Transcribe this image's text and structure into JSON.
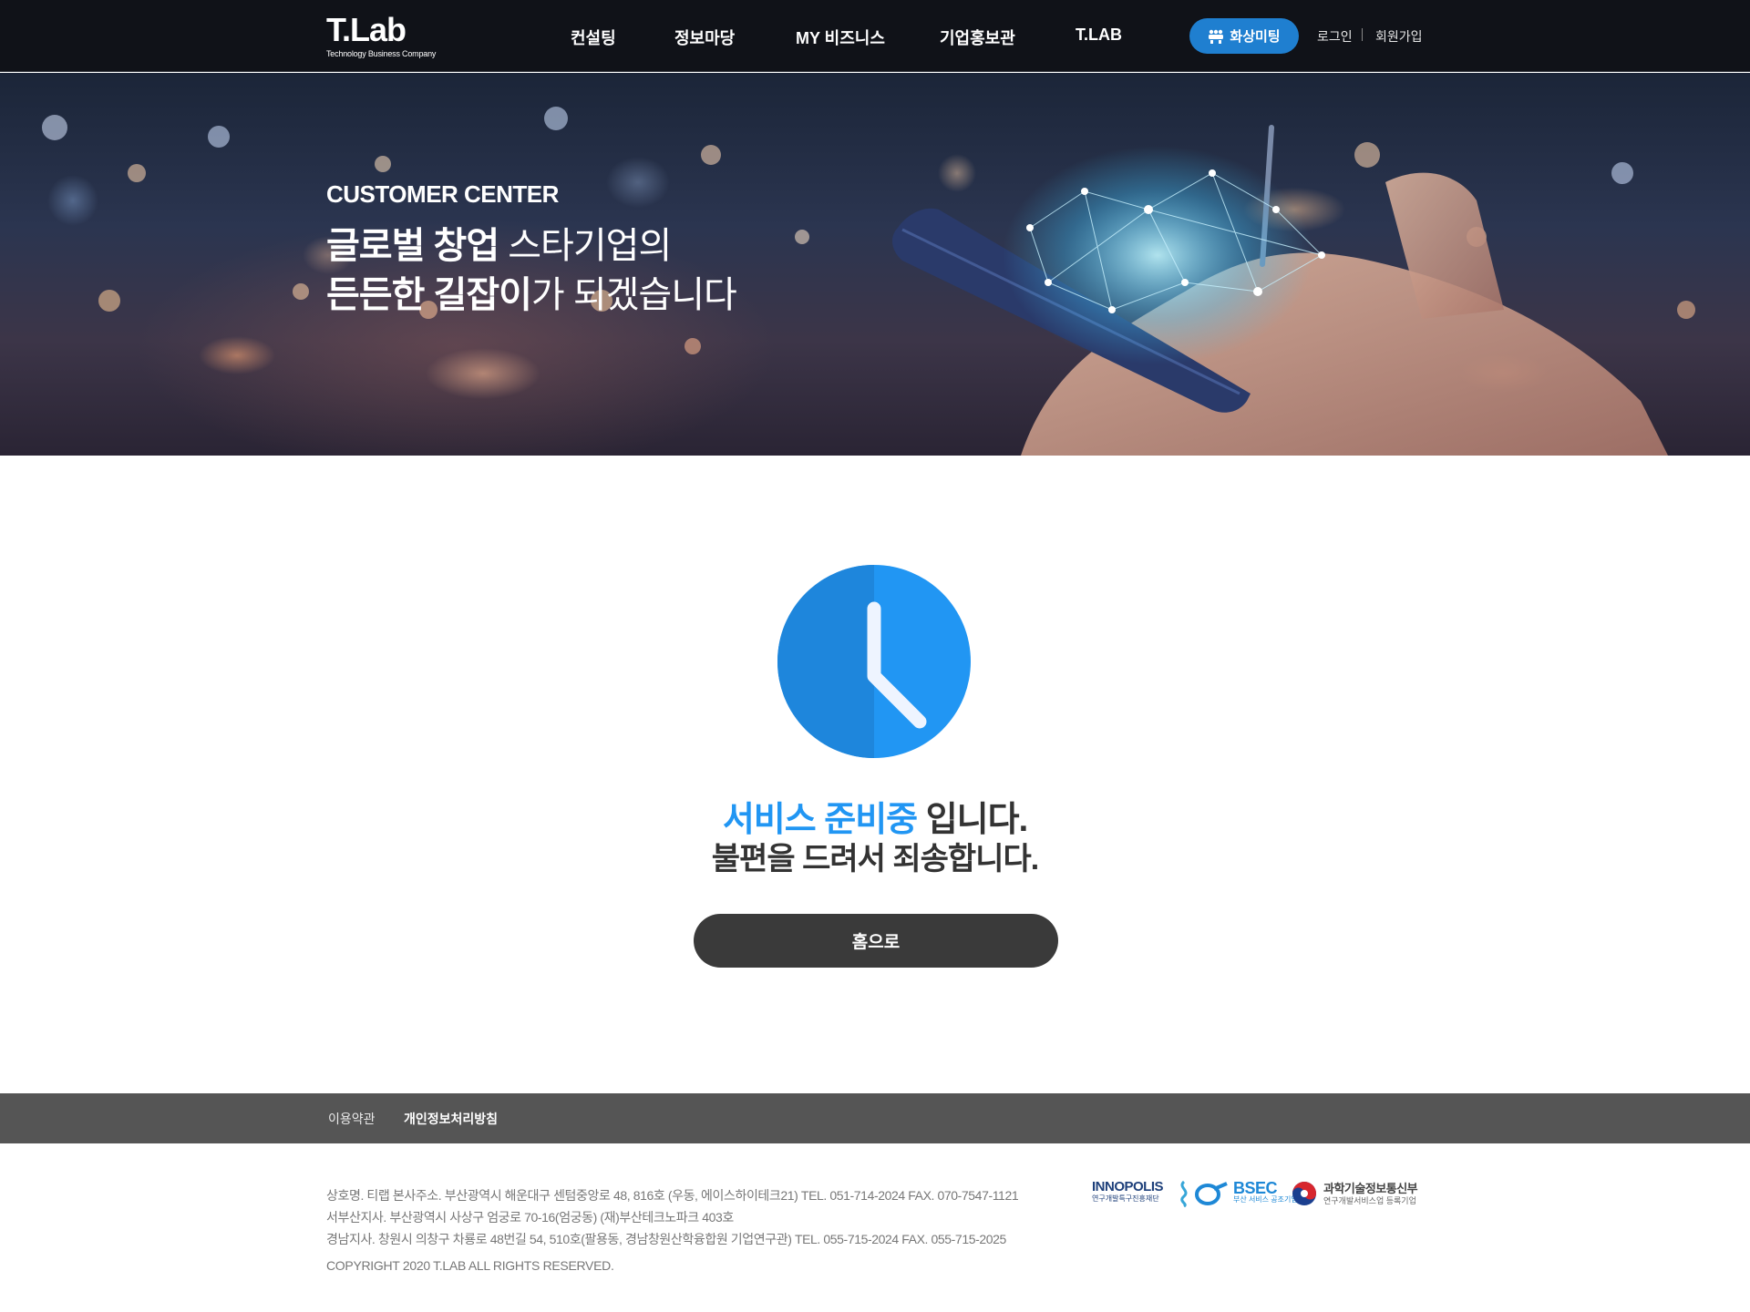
{
  "header": {
    "logo_main": "T.Lab",
    "logo_sub": "Technology Business Company",
    "nav": [
      "컨설팅",
      "정보마당",
      "MY 비즈니스",
      "기업홍보관",
      "T.LAB"
    ],
    "meeting_label": "화상미팅",
    "login_label": "로그인",
    "signup_label": "회원가입"
  },
  "hero": {
    "kicker": "CUSTOMER CENTER",
    "line1_bold": "글로벌 창업",
    "line1_rest": " 스타기업의",
    "line2_bold": "든든한 길잡이",
    "line2_rest": "가 되겠습니다"
  },
  "main": {
    "icon": "clock-icon",
    "msg1_accent": "서비스 준비중",
    "msg1_rest": " 입니다.",
    "msg2": "불편을 드려서 죄송합니다.",
    "home_button": "홈으로"
  },
  "footer": {
    "links": [
      "이용약관",
      "개인정보처리방침"
    ],
    "info": [
      "상호명. 티랩   본사주소. 부산광역시 해운대구 센텀중앙로 48, 816호 (우동, 에이스하이테크21)   TEL. 051-714-2024   FAX. 070-7547-1121",
      "서부산지사. 부산광역시 사상구 엄궁로 70-16(엄궁동) (재)부산테크노파크 403호",
      "경남지사. 창원시 의창구 차룡로 48번길 54, 510호(팔용동, 경남창원산학융합원 기업연구관)   TEL. 055-715-2024   FAX. 055-715-2025"
    ],
    "copyright": "COPYRIGHT 2020 T.LAB ALL RIGHTS RESERVED.",
    "partners": {
      "innopolis_name": "INNOPOLIS",
      "innopolis_sub": "연구개발특구진흥재단",
      "bsec_name": "BSEC",
      "bsec_sub": "부산 서비스 공조기업",
      "msit_name": "과학기술정보통신부",
      "msit_sub": "연구개발서비스업 등록기업"
    }
  },
  "colors": {
    "accent": "#2196f3",
    "header_bg": "#101218",
    "meeting_button": "#1f7fd0",
    "home_button": "#3a3a3a",
    "footer_bar": "#555555"
  }
}
